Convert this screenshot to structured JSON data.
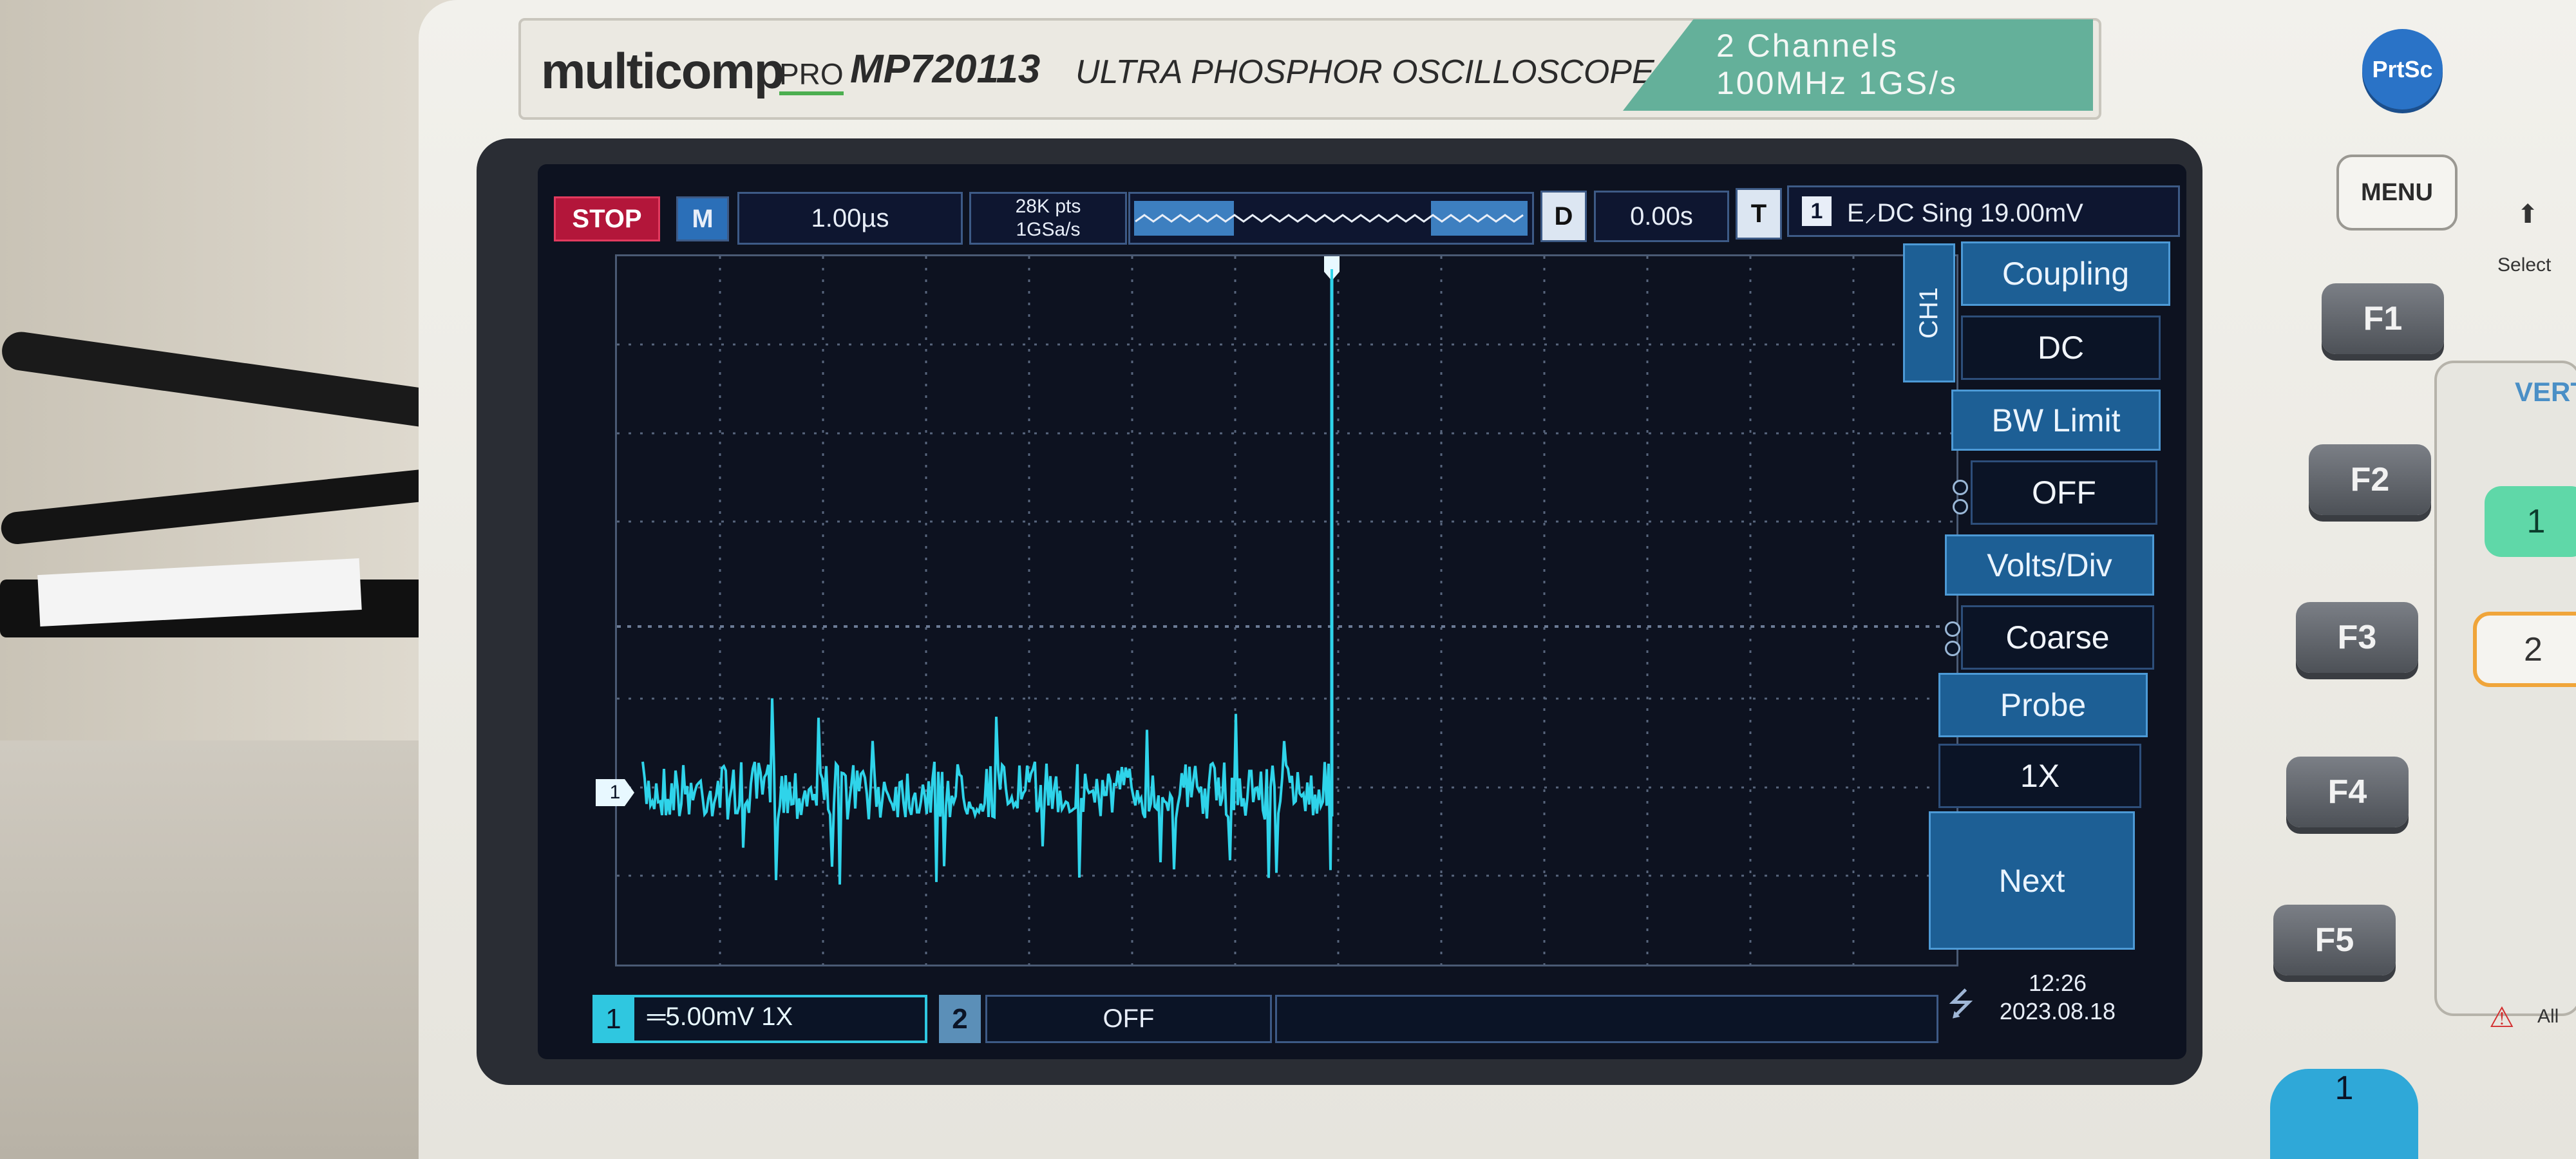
{
  "instrument": {
    "brand": "multicomp",
    "brand_suffix": "PRO",
    "model": "MP720113",
    "subtitle": "ULTRA PHOSPHOR OSCILLOSCOPE",
    "spec_channels": "2 Channels",
    "spec_bandwidth": "100MHz 1GS/s"
  },
  "status_bar": {
    "run_state": "STOP",
    "mode_badge": "M",
    "timebase": "1.00µs",
    "points": "28K pts",
    "sample_rate": "1GSa/s",
    "delay_badge": "D",
    "delay_value": "0.00s",
    "trigger_badge": "T",
    "trigger_channel": "1",
    "trigger_info": "E⸝DC Sing 19.00mV"
  },
  "menu": {
    "channel_tab": "CH1",
    "coupling_label": "Coupling",
    "coupling_value": "DC",
    "bw_label": "BW Limit",
    "bw_value": "OFF",
    "volts_label": "Volts/Div",
    "volts_value": "Coarse",
    "probe_label": "Probe",
    "probe_value": "1X",
    "next_label": "Next"
  },
  "bottom_bar": {
    "ch1_number": "1",
    "ch1_setting": "═5.00mV 1X",
    "ch2_number": "2",
    "ch2_setting": "OFF",
    "time": "12:26",
    "date": "2023.08.18"
  },
  "front_panel": {
    "prtsc": "PrtSc",
    "menu": "MENU",
    "select": "Select",
    "f1": "F1",
    "f2": "F2",
    "f3": "F3",
    "f4": "F4",
    "f5": "F5",
    "vertical": "VERT",
    "ch1_key": "1",
    "ch2_key": "2",
    "all": "All",
    "knob1": "1"
  },
  "waveform": {
    "trace_color": "#2fd4ea",
    "channel_marker": "1"
  },
  "colors": {
    "stop": "#b3163a",
    "menu_active": "#1d5f95",
    "trace": "#2fd4ea",
    "brand_green": "#64b09a"
  }
}
